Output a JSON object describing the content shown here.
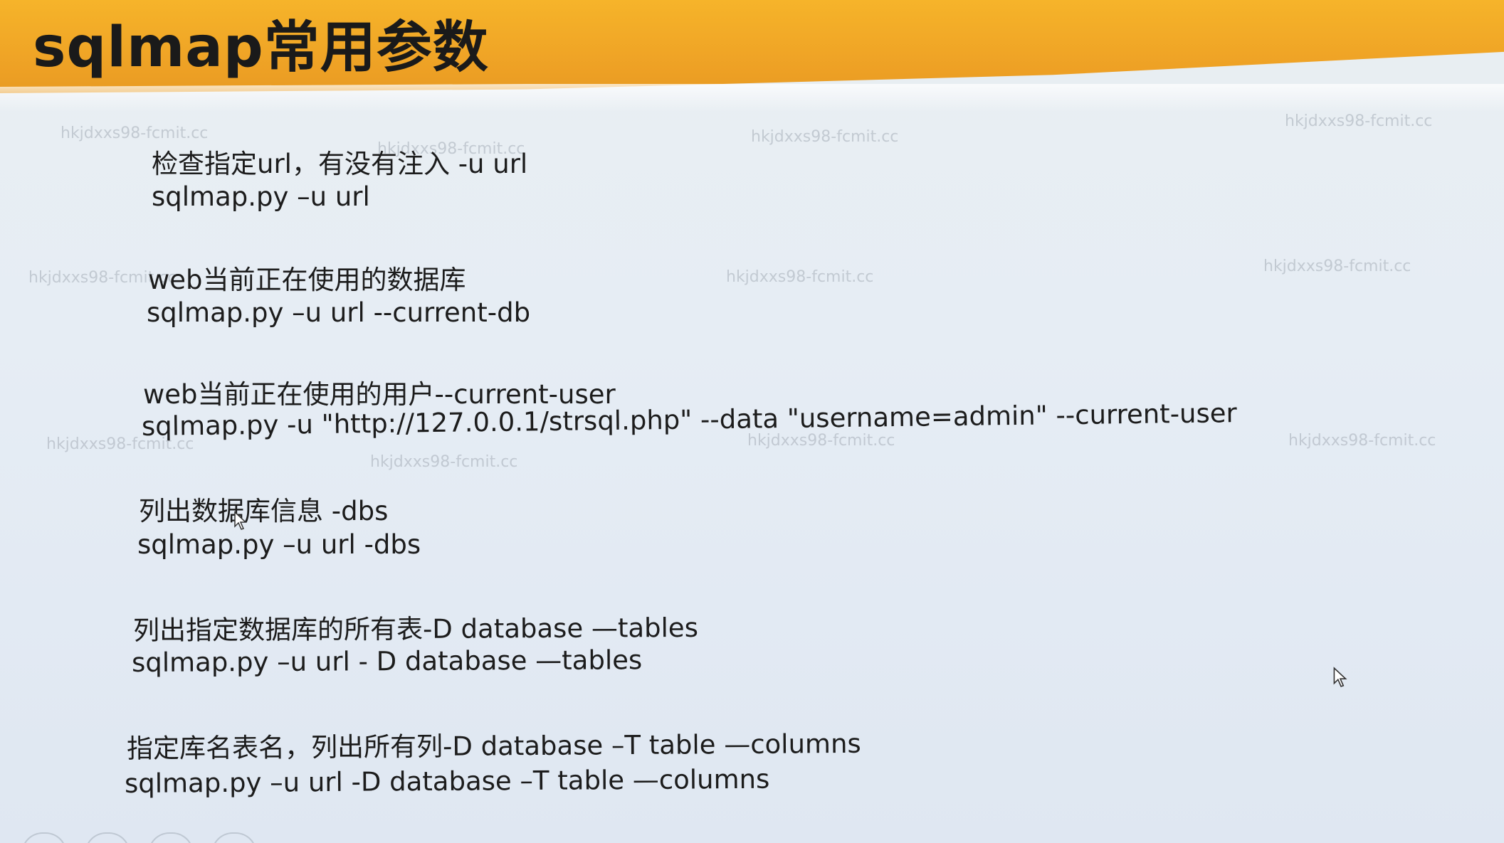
{
  "slide": {
    "title": "sqlmap常用参数",
    "watermark": "hkjdxxs98-fcmit.cc",
    "sections": [
      {
        "heading": "检查指定url，有没有注入 -u url",
        "command": "sqlmap.py –u url"
      },
      {
        "heading": "web当前正在使用的数据库",
        "command": "sqlmap.py –u url --current-db"
      },
      {
        "heading": "web当前正在使用的用户--current-user",
        "command": "sqlmap.py -u \"http://127.0.0.1/strsql.php\"  --data \"username=admin\" --current-user"
      },
      {
        "heading": "列出数据库信息 -dbs",
        "command": "sqlmap.py –u url -dbs"
      },
      {
        "heading": "列出指定数据库的所有表-D database —tables",
        "command": "sqlmap.py –u url - D database —tables"
      },
      {
        "heading": "指定库名表名，列出所有列-D database –T table —columns",
        "command": "sqlmap.py –u url -D database –T table —columns"
      }
    ]
  },
  "colors": {
    "title_bar": "#eea125",
    "text": "#1c1c1c",
    "background": "#e6edf4"
  }
}
